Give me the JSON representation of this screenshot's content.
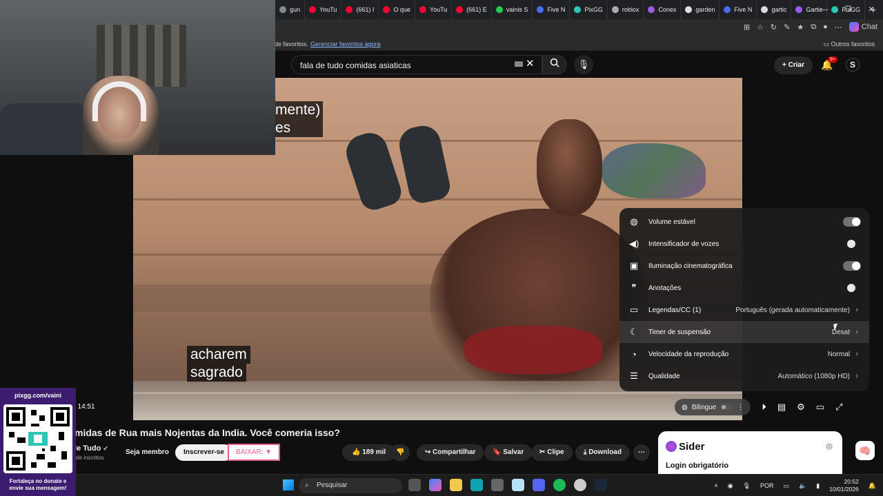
{
  "browser": {
    "tabs": [
      {
        "label": "gun",
        "color": "#888888"
      },
      {
        "label": "YouTu",
        "color": "#ff0033"
      },
      {
        "label": "(661) I",
        "color": "#ff0033"
      },
      {
        "label": "O que",
        "color": "#ff0033"
      },
      {
        "label": "YouTu",
        "color": "#ff0033"
      },
      {
        "label": "(661) E",
        "color": "#ff0033"
      },
      {
        "label": "vainis S",
        "color": "#22cc55"
      },
      {
        "label": "Five N",
        "color": "#4a6cf7"
      },
      {
        "label": "PixGG",
        "color": "#2ec4b6"
      },
      {
        "label": "roblox",
        "color": "#aaaaaa"
      },
      {
        "label": "Conex",
        "color": "#9b5de5"
      },
      {
        "label": "garden",
        "color": "#dddddd"
      },
      {
        "label": "Five N",
        "color": "#4a6cf7"
      },
      {
        "label": "gartic",
        "color": "#dddddd"
      },
      {
        "label": "Gartic",
        "color": "#9b5de5"
      },
      {
        "label": "PixGG",
        "color": "#2ec4b6"
      }
    ],
    "chat_label": "Chat",
    "favorites_text": "de favoritos.",
    "manage_favorites": "Gerenciar favoritos agora",
    "other_favorites": "Outros favoritos"
  },
  "youtube": {
    "search_value": "fala de tudo comidas asiaticas",
    "criar_label": "Criar",
    "notif_badge": "9+",
    "avatar_letter": "S",
    "video": {
      "subtitle_top_1": "mente)",
      "subtitle_top_2": "es",
      "subtitle_line_1": "acharem",
      "subtitle_line_2": "sagrado",
      "time": "/ 14:51",
      "progress": 0.0
    },
    "settings_menu": [
      {
        "label": "Volume estável",
        "icon": "volume-stable-icon",
        "glyph": "◍",
        "type": "toggle",
        "on": true
      },
      {
        "label": "Intensificador de vozes",
        "icon": "voice-boost-icon",
        "glyph": "◀)",
        "type": "toggle",
        "on": false
      },
      {
        "label": "Iluminação cinematográfica",
        "icon": "ambient-mode-icon",
        "glyph": "▣",
        "type": "toggle",
        "on": true
      },
      {
        "label": "Anotações",
        "icon": "annotations-icon",
        "glyph": "❞",
        "type": "toggle",
        "on": false
      },
      {
        "label": "Legendas/CC (1)",
        "icon": "captions-icon",
        "glyph": "▭",
        "type": "menu",
        "value": "Português (gerada automaticamente)"
      },
      {
        "label": "Timer de suspensão",
        "icon": "sleep-timer-icon",
        "glyph": "☾",
        "type": "menu",
        "value": "Desat"
      },
      {
        "label": "Velocidade da reprodução",
        "icon": "playback-speed-icon",
        "glyph": "◔",
        "type": "menu",
        "value": "Normal"
      },
      {
        "label": "Qualidade",
        "icon": "quality-icon",
        "glyph": "☰",
        "type": "menu",
        "value": "Automático (1080p HD)"
      }
    ],
    "bilingue_label": "Bilingue",
    "title": "midas de Rua mais Nojentas da India. Você comeria isso?",
    "channel": "le Tudo",
    "subscribers": "de inscritos",
    "membro_label": "Seja membro",
    "inscrever_label": "Inscrever-se",
    "baixar_label": "BAIXAR: ▼",
    "likes": "189 mil",
    "share_label": "Compartilhar",
    "save_label": "Salvar",
    "clip_label": "Clipe",
    "download_label": "Download"
  },
  "sider": {
    "title": "Sider",
    "login": "Login obrigatório"
  },
  "pixgg": {
    "url": "pixgg.com/vaini",
    "note_1": "Fortaleça no donate e",
    "note_2": "envie sua mensagem!"
  },
  "taskbar": {
    "search_placeholder": "Pesquisar",
    "language": "POR",
    "time": "20:52",
    "date": "10/01/2026"
  }
}
